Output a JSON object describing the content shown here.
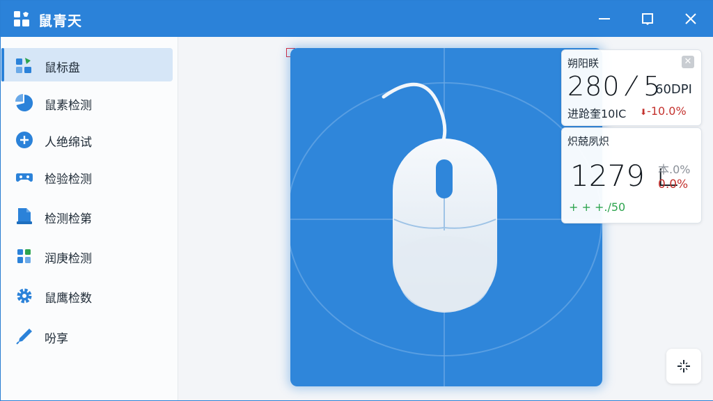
{
  "app": {
    "title": "鼠青天"
  },
  "sidebar": {
    "items": [
      {
        "label": "鼠标盘",
        "icon": "dashboard-icon"
      },
      {
        "label": "鼠素检测",
        "icon": "pie-chart-icon"
      },
      {
        "label": "人绝绵试",
        "icon": "plus-circle-icon"
      },
      {
        "label": "检验检测",
        "icon": "gamepad-icon"
      },
      {
        "label": "检测检第",
        "icon": "document-icon"
      },
      {
        "label": "润庚检测",
        "icon": "puzzle-icon"
      },
      {
        "label": "鼠鹰检数",
        "icon": "gear-icon"
      },
      {
        "label": "吩享",
        "icon": "share-icon"
      }
    ]
  },
  "card1": {
    "title": "朔阳眹",
    "value": "280 ⁄ 5",
    "unit": "60DPI",
    "sub_label": "进跄奎10IC",
    "delta": "-10.0%"
  },
  "card2": {
    "title": "炽兢夙炽",
    "value": "1279 ∟",
    "pct_top": "本.0%",
    "pct_bottom": "0.0%",
    "foot": "+ + +./50"
  },
  "colors": {
    "accent": "#2b82d9",
    "panel": "#2f86da",
    "negative": "#c4332f",
    "positive": "#2da44e"
  }
}
